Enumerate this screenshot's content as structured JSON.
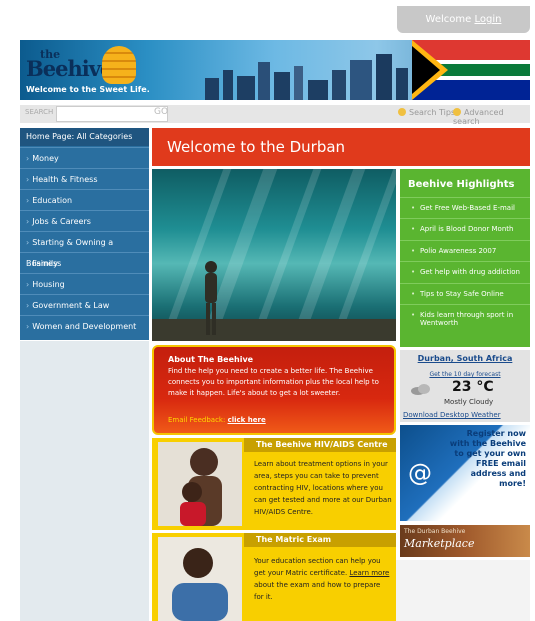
{
  "header": {
    "welcome_prefix": "Welcome",
    "login_label": "Login"
  },
  "banner": {
    "logo_the": "the",
    "logo_name": "Beehive",
    "tagline": "Welcome to the Sweet Life."
  },
  "search": {
    "label": "SEARCH",
    "placeholder": "",
    "go_label": "GO",
    "tips_label": "Search Tips",
    "advanced_label": "Advanced search"
  },
  "sidebar": {
    "home_label": "Home Page: All Categories",
    "items": [
      {
        "label": "Money"
      },
      {
        "label": "Health & Fitness"
      },
      {
        "label": "Education"
      },
      {
        "label": "Jobs & Careers"
      },
      {
        "label": "Starting & Owning a Business"
      },
      {
        "label": "Family"
      },
      {
        "label": "Housing"
      },
      {
        "label": "Government & Law"
      },
      {
        "label": "Women and Development"
      }
    ]
  },
  "main": {
    "title": "Welcome to the Durban Beehive"
  },
  "highlights": {
    "title": "Beehive Highlights",
    "items": [
      {
        "label": "Get Free Web-Based E-mail"
      },
      {
        "label": "April is Blood Donor Month"
      },
      {
        "label": "Polio Awareness 2007"
      },
      {
        "label": "Get help with drug addiction"
      },
      {
        "label": "Tips to Stay Safe Online"
      },
      {
        "label": "Kids learn through sport in Wentworth"
      }
    ]
  },
  "about": {
    "title": "About The Beehive",
    "text": "Find the help you need to create a better life. The Beehive connects you to important information plus the local help to make it happen. Life's about to get a lot sweeter.",
    "feedback_label": "Email Feedback:",
    "feedback_link": "click here"
  },
  "hiv": {
    "title": "The Beehive HIV/AIDS Centre",
    "text": "Learn about treatment options in your area, steps you can take to prevent contracting HIV, locations where you can get tested and more at our Durban HIV/AIDS Centre."
  },
  "matric": {
    "title": "The Matric Exam",
    "text_before": "Your education section can help you get your Matric certificate.",
    "link": "Learn more",
    "text_after": "about the exam and how to prepare for it."
  },
  "weather": {
    "city": "Durban, South Africa",
    "forecast_link": "Get the 10 day forecast",
    "temp": "23 °C",
    "desc": "Mostly Cloudy",
    "download": "Download Desktop Weather",
    "icon": "cloud-icon"
  },
  "register": {
    "text": "Register now with the Beehive to get your own FREE email address and more!"
  },
  "marketplace": {
    "small": "The Durban Beehive",
    "big": "Marketplace"
  }
}
